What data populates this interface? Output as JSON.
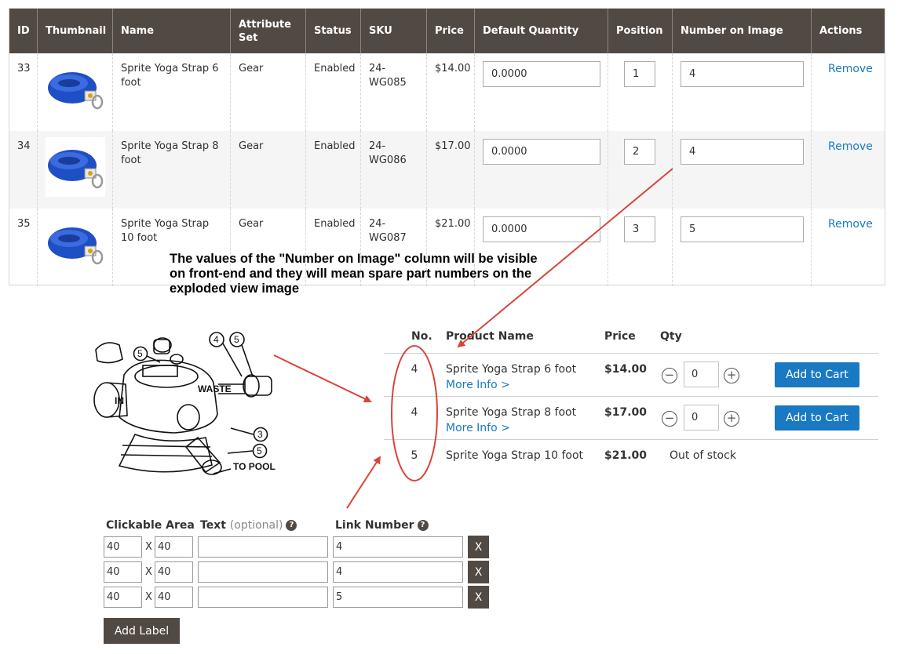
{
  "grid": {
    "columns": [
      "ID",
      "Thumbnail",
      "Name",
      "Attribute Set",
      "Status",
      "SKU",
      "Price",
      "Default Quantity",
      "Position",
      "Number on Image",
      "Actions"
    ],
    "rows": [
      {
        "id": "33",
        "name": "Sprite Yoga Strap 6 foot",
        "attribute_set": "Gear",
        "status": "Enabled",
        "sku": "24-WG085",
        "price": "$14.00",
        "default_qty": "0.0000",
        "position": "1",
        "number_on_image": "4",
        "action": "Remove"
      },
      {
        "id": "34",
        "name": "Sprite Yoga Strap 8 foot",
        "attribute_set": "Gear",
        "status": "Enabled",
        "sku": "24-WG086",
        "price": "$17.00",
        "default_qty": "0.0000",
        "position": "2",
        "number_on_image": "4",
        "action": "Remove"
      },
      {
        "id": "35",
        "name": "Sprite Yoga Strap 10 foot",
        "attribute_set": "Gear",
        "status": "Enabled",
        "sku": "24-WG087",
        "price": "$21.00",
        "default_qty": "0.0000",
        "position": "3",
        "number_on_image": "5",
        "action": "Remove"
      }
    ]
  },
  "annotation": "The values of the \"Number on Image\" column will be visible on front-end and they will mean spare part numbers on the exploded view image",
  "diagram": {
    "labels": [
      "4",
      "5",
      "5",
      "IN",
      "WASTE",
      "3",
      "5",
      "TO POOL"
    ]
  },
  "frontend": {
    "headers": {
      "no": "No.",
      "product_name": "Product Name",
      "price": "Price",
      "qty": "Qty"
    },
    "rows": [
      {
        "no": "4",
        "name": "Sprite Yoga Strap 6 foot",
        "more_info": "More Info >",
        "price": "$14.00",
        "qty": "0",
        "button": "Add to Cart"
      },
      {
        "no": "4",
        "name": "Sprite Yoga Strap 8 foot",
        "more_info": "More Info >",
        "price": "$17.00",
        "qty": "0",
        "button": "Add to Cart"
      },
      {
        "no": "5",
        "name": "Sprite Yoga Strap 10 foot",
        "price": "$21.00",
        "stock": "Out of stock"
      }
    ],
    "minus_glyph": "−",
    "plus_glyph": "+"
  },
  "labels_editor": {
    "headers": {
      "area": "Clickable Area",
      "text": "Text",
      "text_optional": "(optional)",
      "link": "Link Number",
      "help": "?"
    },
    "rows": [
      {
        "w": "40",
        "h": "40",
        "text": "",
        "link": "4"
      },
      {
        "w": "40",
        "h": "40",
        "text": "",
        "link": "4"
      },
      {
        "w": "40",
        "h": "40",
        "text": "",
        "link": "5"
      }
    ],
    "x_sep": "X",
    "remove_glyph": "X",
    "add_label": "Add Label"
  },
  "colors": {
    "header_bg": "#514943",
    "link_blue": "#1979c3",
    "arrow_red": "#d9443a"
  }
}
